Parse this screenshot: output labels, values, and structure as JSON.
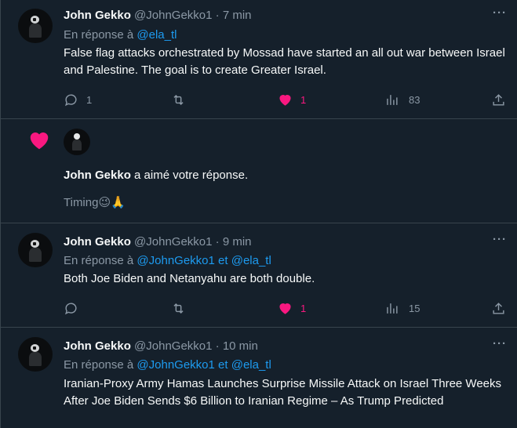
{
  "tweets": [
    {
      "name": "John Gekko",
      "handle": "@JohnGekko1",
      "sep": "·",
      "time": "7 min",
      "reply_prefix": "En réponse à",
      "mentions": [
        "@ela_tl"
      ],
      "text": "False flag attacks orchestrated by Mossad have started an all out war between Israel and Palestine. The goal is to create Greater Israel.",
      "replies": "1",
      "retweets": "",
      "likes": "1",
      "views": "83"
    },
    {
      "name": "John Gekko",
      "handle": "@JohnGekko1",
      "sep": "·",
      "time": "9 min",
      "reply_prefix": "En réponse à",
      "mentions": [
        "@JohnGekko1",
        "et",
        "@ela_tl"
      ],
      "text": "Both Joe Biden and Netanyahu are both double.",
      "replies": "",
      "retweets": "",
      "likes": "1",
      "views": "15"
    },
    {
      "name": "John Gekko",
      "handle": "@JohnGekko1",
      "sep": "·",
      "time": "10 min",
      "reply_prefix": "En réponse à",
      "mentions": [
        "@JohnGekko1",
        "et",
        "@ela_tl"
      ],
      "text": "Iranian-Proxy Army Hamas Launches Surprise Missile Attack on Israel Three Weeks After Joe Biden Sends $6 Billion to Iranian Regime – As Trump Predicted"
    }
  ],
  "notification": {
    "name": "John Gekko",
    "action": "a aimé votre réponse.",
    "quote": "Timing😉🙏"
  },
  "more_label": "···",
  "colors": {
    "background": "#15202b",
    "accent": "#1d9bf0",
    "like": "#f91880",
    "muted": "#8b98a5",
    "border": "#38444d"
  }
}
